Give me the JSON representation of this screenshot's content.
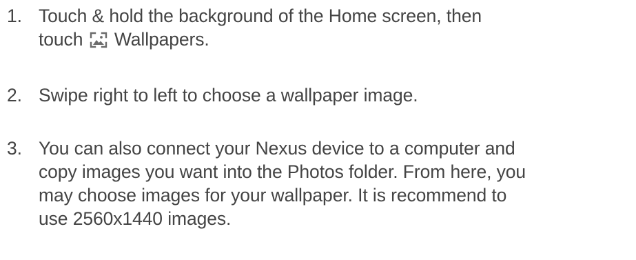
{
  "steps": [
    {
      "number": "1.",
      "lines": [
        "Touch & hold the background of the Home screen, then",
        "touch"
      ],
      "after_icon": "Wallpapers.",
      "icon": "wallpaper-icon"
    },
    {
      "number": "2.",
      "lines": [
        "Swipe right to left to choose a wallpaper image."
      ]
    },
    {
      "number": "3.",
      "lines": [
        "You can also connect your Nexus device to a computer and",
        "copy images you want into the Photos folder.  From here, you",
        "may choose images for your wallpaper. It is recommend to",
        "use 2560x1440 images."
      ]
    }
  ],
  "colors": {
    "text": "#444444",
    "icon": "#6b6b6b"
  }
}
